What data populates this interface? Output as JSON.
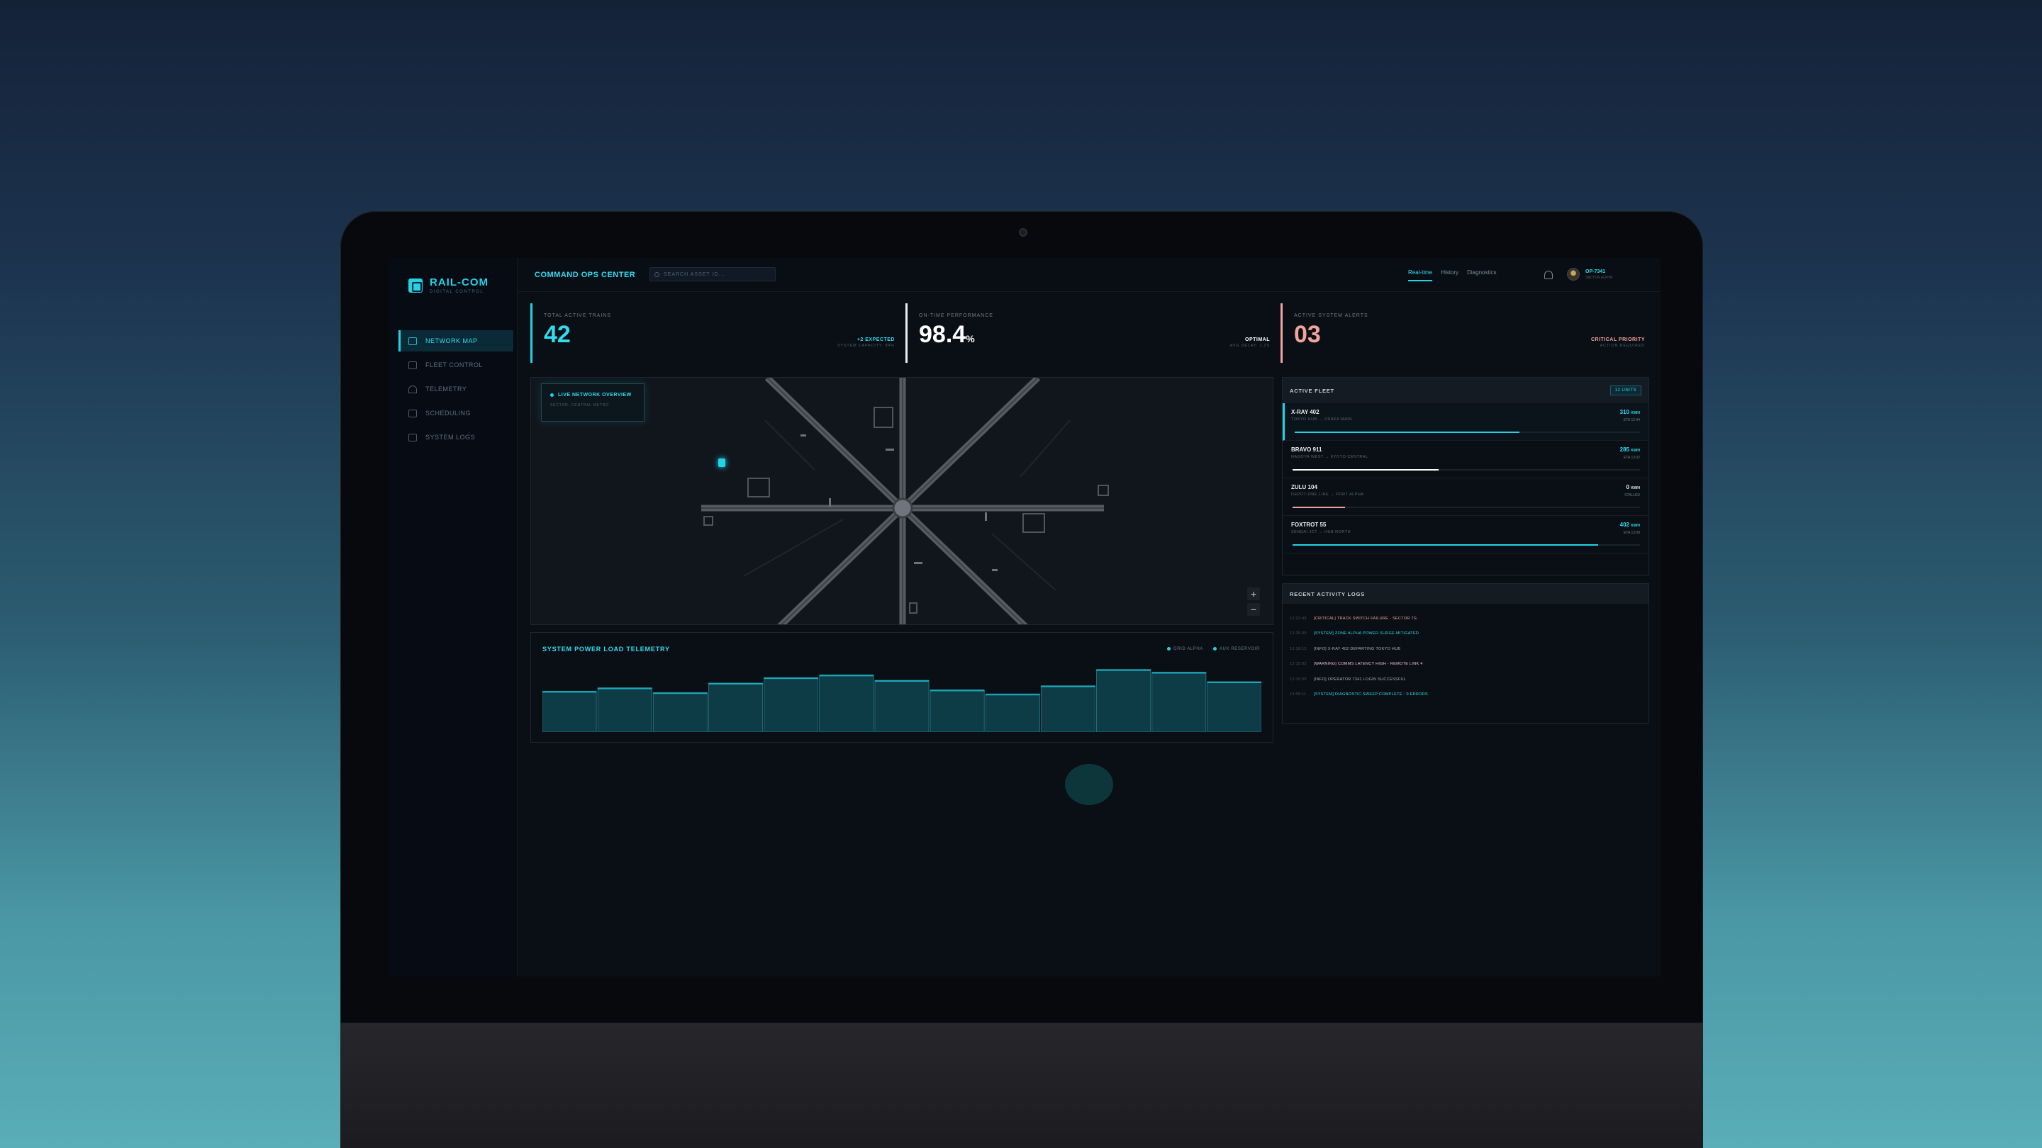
{
  "app": {
    "brand": "RAIL-COM",
    "brand_sub": "DIGITAL CONTROL",
    "page_title": "COMMAND OPS CENTER"
  },
  "search": {
    "placeholder": "SEARCH ASSET ID..."
  },
  "sidebar": {
    "items": [
      {
        "label": "NETWORK MAP",
        "icon": "map-icon",
        "active": true
      },
      {
        "label": "FLEET CONTROL",
        "icon": "train-icon",
        "active": false
      },
      {
        "label": "TELEMETRY",
        "icon": "signal-icon",
        "active": false
      },
      {
        "label": "SCHEDULING",
        "icon": "calendar-icon",
        "active": false
      },
      {
        "label": "SYSTEM LOGS",
        "icon": "terminal-icon",
        "active": false
      }
    ]
  },
  "topbar": {
    "tabs": [
      {
        "label": "Real-time",
        "active": true
      },
      {
        "label": "History",
        "active": false
      },
      {
        "label": "Diagnostics",
        "active": false
      }
    ],
    "user_name": "OP-7341",
    "user_role": "SECTOR ALPHA"
  },
  "kpis": [
    {
      "label": "TOTAL ACTIVE TRAINS",
      "value": "42",
      "note": "+2 EXPECTED",
      "sub": "SYSTEM CAPACITY: 84%",
      "color": "#22d3e6"
    },
    {
      "label": "ON-TIME PERFORMANCE",
      "value": "98.4",
      "unit": "%",
      "note": "OPTIMAL",
      "sub": "AVG DELAY: 1.2S",
      "color": "#ffffff"
    },
    {
      "label": "ACTIVE SYSTEM ALERTS",
      "value": "03",
      "note": "CRITICAL PRIORITY",
      "sub": "ACTION REQUIRED",
      "color": "#f2a39c"
    }
  ],
  "map": {
    "title": "LIVE NETWORK OVERVIEW",
    "subtitle": "SECTOR: CENTRAL METRO",
    "zoom_in": "+",
    "zoom_out": "−"
  },
  "chart_title": "SYSTEM POWER LOAD TELEMETRY",
  "chart_data": {
    "type": "bar",
    "title": "SYSTEM POWER LOAD TELEMETRY",
    "values": [
      60,
      65,
      58,
      72,
      80,
      84,
      76,
      62,
      56,
      68,
      92,
      88,
      74
    ],
    "series": [
      {
        "name": "GRID ALPHA",
        "color": "#22d3e6"
      },
      {
        "name": "AUX RESERVOIR",
        "color": "#22d3e6"
      }
    ],
    "ylim": [
      0,
      100
    ],
    "grid": false,
    "legend": "top-right"
  },
  "fleet": {
    "title": "ACTIVE FLEET",
    "badge": "12 UNITS",
    "rows": [
      {
        "name": "X-RAY 402",
        "route": "TOKYO HUB → OSAKA MAIN",
        "speed": "310",
        "unit": "KM/H",
        "eta": "ETA 12:44",
        "progress": 0.65,
        "color": "#22d3e6",
        "active": true
      },
      {
        "name": "BRAVO 911",
        "route": "NAGOYA WEST → KYOTO CENTRAL",
        "speed": "285",
        "unit": "KM/H",
        "eta": "ETA 13:02",
        "progress": 0.42,
        "color": "#ffffff",
        "active": false
      },
      {
        "name": "ZULU 104",
        "route": "DEPOT-ONE LINE → PORT ALPHA",
        "speed": "0",
        "unit": "KM/H",
        "eta": "STALLED",
        "progress": 0.15,
        "color": "#f2a39c",
        "active": false
      },
      {
        "name": "FOXTROT 55",
        "route": "SENDAI JCT → HUB NORTH",
        "speed": "402",
        "unit": "KM/H",
        "eta": "ETA 13:09",
        "progress": 0.88,
        "color": "#22d3e6",
        "active": false
      }
    ]
  },
  "logs": {
    "title": "RECENT ACTIVITY LOGS",
    "rows": [
      {
        "time": "12:22:45",
        "text": "[CRITICAL] TRACK SWITCH FAILURE - SECTOR 7G",
        "level": "critical"
      },
      {
        "time": "12:20:30",
        "text": "[SYSTEM] ZONE ALPHA POWER SURGE MITIGATED",
        "level": "cyan"
      },
      {
        "time": "12:18:12",
        "text": "[INFO] X-RAY 402 DEPARTING TOKYO HUB",
        "level": "info"
      },
      {
        "time": "12:15:02",
        "text": "[WARNING] COMMS LATENCY HIGH - REMOTE LINK 4",
        "level": "warn"
      },
      {
        "time": "12:10:55",
        "text": "[INFO] OPERATOR 7341 LOGIN SUCCESSFUL",
        "level": "info"
      },
      {
        "time": "12:05:11",
        "text": "[SYSTEM] DIAGNOSTIC SWEEP COMPLETE - 0 ERRORS",
        "level": "cyan"
      }
    ]
  }
}
